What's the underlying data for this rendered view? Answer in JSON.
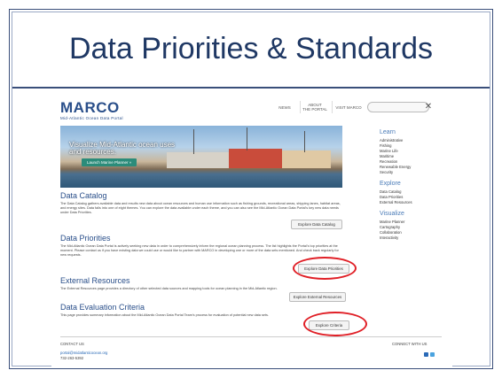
{
  "slide": {
    "title": "Data Priorities & Standards"
  },
  "site": {
    "logo": "MARCO",
    "logo_sub": "Mid-Atlantic Ocean Data Portal",
    "nav": [
      "NEWS",
      "ABOUT\nTHE PORTAL",
      "VISIT MARCO"
    ],
    "search_clear": "✕"
  },
  "hero": {
    "text": "Visualize Mid-Atlantic ocean uses and resources.",
    "button": "Launch Marine Planner »"
  },
  "sections": {
    "catalog": {
      "heading": "Data Catalog",
      "body": "The Data Catalog gathers available data and results new data about ocean resources and human use information such as fishing grounds, recreational areas, shipping lanes, habitat areas, and energy sites. Data falls into one of eight themes. You can explore the data available under each theme, and you can also see the Mid-Atlantic Ocean Data Portal's key new data needs under Data Priorities.",
      "button": "Explore Data Catalog"
    },
    "priorities": {
      "heading": "Data Priorities",
      "body": "The Mid-Atlantic Ocean Data Portal is actively seeking new data in order to comprehensively inform the regional ocean planning process. The list highlights the Portal's top priorities at the moment. Please contact us if you have existing data we could use or would like to partner with MARCO in developing one or more of the data sets mentioned. And check back regularly for new requests.",
      "button": "Explore Data Priorities"
    },
    "external": {
      "heading": "External Resources",
      "body": "The External Resources page provides a directory of other selected data sources and mapping tools for ocean planning in the Mid-Atlantic region.",
      "button": "Explore External Resources"
    },
    "criteria": {
      "heading": "Data Evaluation Criteria",
      "body": "This page provides summary information about the Mid-Atlantic Ocean Data Portal Team's process for evaluation of potential new data sets.",
      "button": "Explore Criteria"
    }
  },
  "sidebar": {
    "learn": {
      "heading": "Learn",
      "items": [
        "Administrative",
        "Fishing",
        "Marine Life",
        "Maritime",
        "Recreation",
        "Renewable Energy",
        "Security"
      ]
    },
    "explore": {
      "heading": "Explore",
      "items": [
        "Data Catalog",
        "Data Priorities",
        "External Resources"
      ]
    },
    "visualize": {
      "heading": "Visualize",
      "items": [
        "Marine Planner",
        "Cartography",
        "Collaboration",
        "Interactivity"
      ]
    }
  },
  "footer": {
    "contact_label": "CONTACT US",
    "email": "portal@midatlanticocean.org",
    "phone": "732-263-5392",
    "connect_label": "CONNECT WITH US"
  },
  "colors": {
    "title": "#1f3864",
    "accent": "#2a4f8a",
    "highlight": "#e01f26"
  }
}
